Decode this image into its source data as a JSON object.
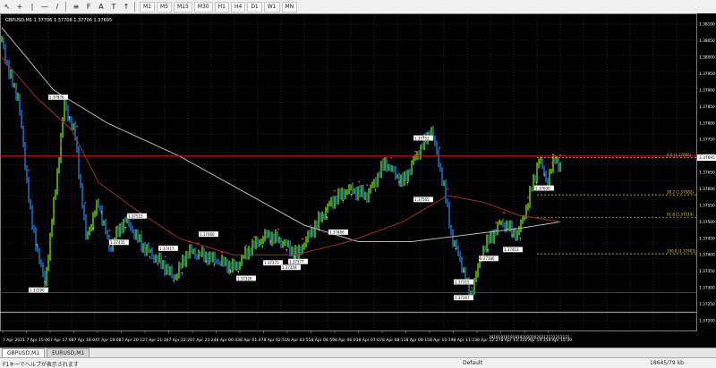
{
  "toolbar": {
    "icons": [
      "cursor-icon",
      "crosshair-icon",
      "vertical-line-icon",
      "horizontal-line-icon",
      "trendline-icon",
      "channel-icon",
      "fibonacci-icon",
      "text-icon",
      "label-icon",
      "arrow-icon"
    ],
    "timeframes": [
      "M1",
      "M5",
      "M15",
      "M30",
      "H1",
      "H4",
      "D1",
      "W1",
      "MN"
    ]
  },
  "chart": {
    "info": "GBPUSD,M1  1.37706 1.37708 1.37706 1.37695",
    "current_price": "1.37695",
    "price_ticks": [
      "1.38100",
      "1.38050",
      "1.38000",
      "1.37950",
      "1.37900",
      "1.37850",
      "1.37800",
      "1.37750",
      "1.37700",
      "1.37650",
      "1.37600",
      "1.37550",
      "1.37500",
      "1.37450",
      "1.37400",
      "1.37350",
      "1.37300",
      "1.37250",
      "1.37200"
    ],
    "time_ticks": [
      "7 Apr 2021",
      "7 Apr 15:06",
      "7 Apr 17:08",
      "7 Apr 18:04",
      "7 Apr 19:08",
      "7 Apr 20:12",
      "7 Apr 21:16",
      "7 Apr 22:20",
      "7 Apr 23:24",
      "8 Apr 00:43",
      "8 Apr 01:47",
      "8 Apr 02:51",
      "8 Apr 03:55",
      "8 Apr 04:59",
      "8 Apr 06:03",
      "8 Apr 07:07",
      "8 Apr 08:11",
      "8 Apr 09:15",
      "8 Apr 10:19",
      "8 Apr 11:23",
      "8 Apr 12:27",
      "8 Apr 13:31",
      "8 Apr 14:35",
      "8 Apr 15:39"
    ],
    "fib_labels": [
      "0.0 (1.37695)",
      "38.2 (1.37582)",
      "61.8 (1.37514)",
      "100.0 (1.37403)"
    ],
    "swing_labels": [
      "1.37876",
      "1.37290",
      "1.37515",
      "1.37435",
      "1.37460",
      "1.37417",
      "1.37326",
      "1.37373",
      "1.37359",
      "1.37466",
      "1.37377",
      "1.37565",
      "1.37752",
      "1.37315",
      "1.37600",
      "1.37413",
      "1.37267",
      "1.37386"
    ],
    "sub_labels": "1919191919191920202020212121212121",
    "colors": {
      "background": "#000000",
      "grid": "#3a3a3a",
      "bull": "#7cfc00",
      "bear": "#1e90ff",
      "ma_slow": "#b8b8b8",
      "ma_fast": "#a52a2a",
      "level": "#d02020",
      "fib": "#e8c84a",
      "marker": "#ff3030"
    }
  },
  "tabs": [
    "GBPUSD,M1",
    "EURUSD,M1"
  ],
  "status": {
    "help": "F1キーでヘルプが表示されます",
    "profile": "Default",
    "traffic": "18645/79 kb"
  }
}
